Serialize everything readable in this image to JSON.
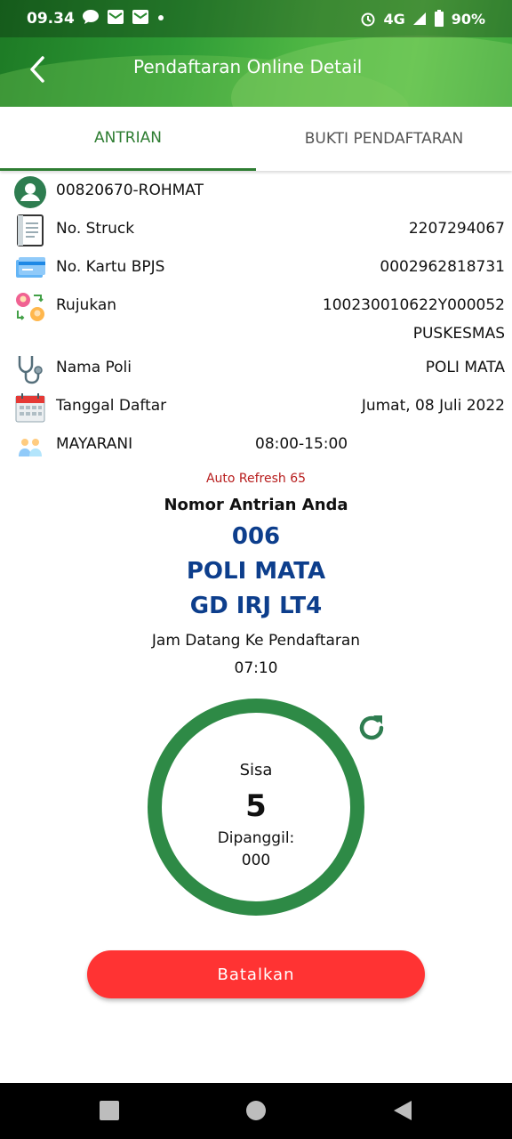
{
  "status_bar": {
    "time": "09.34",
    "network": "4G",
    "battery": "90%",
    "left_icons": [
      "chat-bubble-icon",
      "mail-icon",
      "mail-icon",
      "dot-icon"
    ],
    "right_icons": [
      "alarm-icon",
      "signal-icon",
      "battery-icon"
    ]
  },
  "app_bar": {
    "title": "Pendaftaran Online Detail",
    "back_icon": "arrow-back-icon"
  },
  "tabs": [
    {
      "label": "ANTRIAN",
      "active": true
    },
    {
      "label": "BUKTI PENDAFTARAN",
      "active": false
    }
  ],
  "details": {
    "patient": {
      "icon": "person-icon",
      "label": "00820670-ROHMAT"
    },
    "struck": {
      "icon": "document-icon",
      "label": "No. Struck",
      "value": "2207294067"
    },
    "bpjs": {
      "icon": "card-icon",
      "label": "No. Kartu BPJS",
      "value": "0002962818731"
    },
    "rujukan": {
      "icon": "referral-icon",
      "label": "Rujukan",
      "value": "100230010622Y000052",
      "value2": "PUSKESMAS"
    },
    "poli": {
      "icon": "stethoscope-icon",
      "label": "Nama Poli",
      "value": "POLI MATA"
    },
    "tanggal": {
      "icon": "calendar-icon",
      "label": "Tanggal Daftar",
      "value": "Jumat, 08 Juli 2022"
    },
    "dokter": {
      "icon": "doctors-icon",
      "label": "MAYARANI",
      "value": "08:00-15:00"
    }
  },
  "queue": {
    "auto_refresh": "Auto Refresh 65",
    "title": "Nomor Antrian Anda",
    "number": "006",
    "poli": "POLI MATA",
    "location": "GD IRJ LT4",
    "arrival_label": "Jam Datang Ke Pendaftaran",
    "arrival_time": "07:10",
    "remaining_label": "Sisa",
    "remaining_value": "5",
    "called_label": "Dipanggil:",
    "called_value": "000"
  },
  "colors": {
    "primary": "#2e7d32",
    "queue_text": "#0d3e8c",
    "cancel": "#ff3333",
    "refresh_text": "#b71c1c"
  },
  "cancel_button": {
    "label": "Batalkan"
  },
  "nav": [
    "square-icon",
    "circle-icon",
    "triangle-back-icon"
  ]
}
